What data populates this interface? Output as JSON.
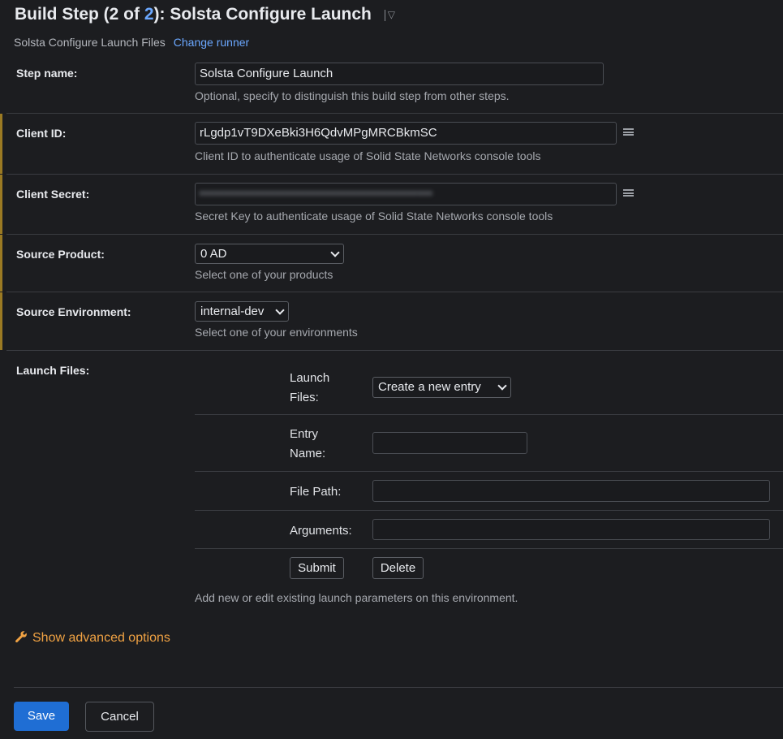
{
  "header": {
    "title_prefix": "Build Step (2 of ",
    "title_step_link": "2",
    "title_suffix": "): Solsta Configure Launch",
    "subtitle": "Solsta Configure Launch Files",
    "change_runner": "Change runner"
  },
  "step_name": {
    "label": "Step name:",
    "value": "Solsta Configure Launch",
    "hint": "Optional, specify to distinguish this build step from other steps."
  },
  "client_id": {
    "label": "Client ID:",
    "value": "rLgdp1vT9DXeBki3H6QdvMPgMRCBkmSC",
    "hint": "Client ID to authenticate usage of Solid State Networks console tools"
  },
  "client_secret": {
    "label": "Client Secret:",
    "value": "••••••••••••••••••••••••••••••••••••••••••••••",
    "hint": "Secret Key to authenticate usage of Solid State Networks console tools"
  },
  "source_product": {
    "label": "Source Product:",
    "value": "0 AD",
    "hint": "Select one of your products"
  },
  "source_environment": {
    "label": "Source Environment:",
    "value": "internal-dev",
    "hint": "Select one of your environments"
  },
  "launch_files": {
    "label": "Launch Files:",
    "launch_files_label_line1": "Launch",
    "launch_files_label_line2": "Files:",
    "launch_files_value": "Create a new entry",
    "entry_name_label_line1": "Entry",
    "entry_name_label_line2": "Name:",
    "entry_name_value": "",
    "file_path_label": "File Path:",
    "file_path_value": "",
    "arguments_label": "Arguments:",
    "arguments_value": "",
    "submit": "Submit",
    "delete": "Delete",
    "hint": "Add new or edit existing launch parameters on this environment."
  },
  "advanced": "Show advanced options",
  "footer": {
    "save": "Save",
    "cancel": "Cancel"
  },
  "colors": {
    "accent": "#1f6ed4",
    "link": "#6ba8ff",
    "advanced": "#f0a243",
    "required_bar": "#9b7a23"
  }
}
